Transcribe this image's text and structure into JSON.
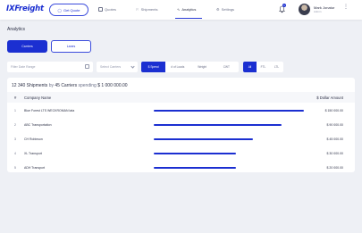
{
  "header": {
    "logo": "IXFreight",
    "get_quote": "Get Quote",
    "nav": [
      {
        "label": "Quotes"
      },
      {
        "label": "Shipments"
      },
      {
        "label": "Analytics"
      },
      {
        "label": "Settings"
      }
    ],
    "notifications_count": "1",
    "user": {
      "name": "Mark Jonatur",
      "role": "Admin"
    }
  },
  "page": {
    "title": "Analytics"
  },
  "tabs": [
    {
      "label": "Carriers",
      "active": true
    },
    {
      "label": "Lanes",
      "active": false
    }
  ],
  "filters": {
    "date_placeholder": "Filter Date Range",
    "carrier_placeholder": "Select Carriers",
    "metric": [
      "$ Spend",
      "# of Loads",
      "Weight",
      "CWT"
    ],
    "mode": [
      "All",
      "FTL",
      "LTL"
    ]
  },
  "summary": {
    "shipments": "12 340 Shipments",
    "by": "by",
    "carriers": "45 Carriers",
    "spending": "spending",
    "amount": "$ 1 000 000.00"
  },
  "table": {
    "headers": {
      "num": "#",
      "name": "Company Name",
      "amount": "$ Dollar Amount"
    },
    "rows": [
      {
        "num": "1",
        "name": "Blue Forest LTS WECKROMAN lata",
        "amount": "$ 150 000.00",
        "bar_pct": 100
      },
      {
        "num": "2",
        "name": "ABC Transportation",
        "amount": "$ 90 000.00",
        "bar_pct": 85
      },
      {
        "num": "3",
        "name": "CH Robinson",
        "amount": "$ 45 000.00",
        "bar_pct": 66
      },
      {
        "num": "4",
        "name": "XL Transport",
        "amount": "$ 30 000.00",
        "bar_pct": 55
      },
      {
        "num": "5",
        "name": "ADH Transport",
        "amount": "$ 20 000.00",
        "bar_pct": 55
      }
    ]
  },
  "colors": {
    "accent": "#1b2fd1"
  }
}
